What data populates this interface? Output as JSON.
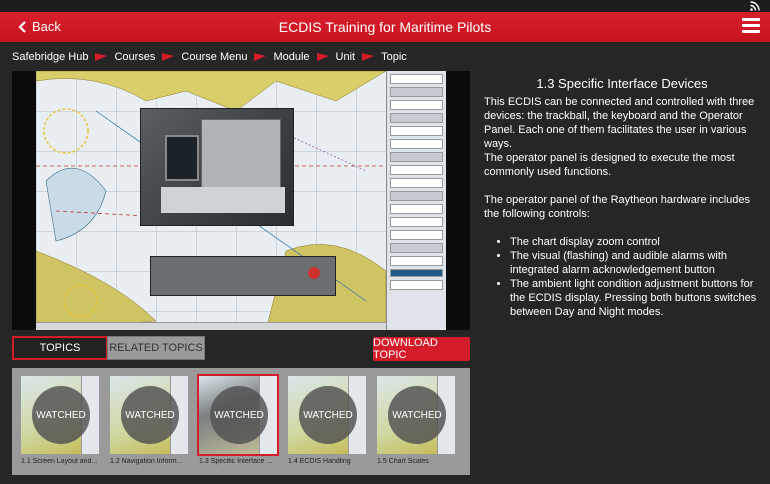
{
  "header": {
    "back_label": "Back",
    "title": "ECDIS Training for Maritime Pilots",
    "rss_icon": "rss-icon",
    "menu_icon": "hamburger-menu-icon",
    "accent_color": "#d51c2a"
  },
  "breadcrumb": [
    "Safebridge Hub",
    "Courses",
    "Course Menu",
    "Module",
    "Unit",
    "Topic"
  ],
  "content": {
    "heading": "1.3 Specific Interface Devices",
    "paragraph1": "This ECDIS can be connected and controlled with three devices: the trackball, the keyboard and the Operator Panel. Each one of them facilitates the user in various ways.",
    "paragraph2": "The operator panel is designed to execute the most commonly used functions.",
    "paragraph3": "The operator panel of the Raytheon hardware includes the following controls:",
    "bullets": [
      "The chart display zoom control",
      "The visual (flashing) and audible alarms with integrated alarm acknowledgement button",
      "The ambient light condition adjustment buttons for the ECDIS display. Pressing both buttons switches between Day and Night modes."
    ]
  },
  "tabs": {
    "topics": "TOPICS",
    "related": "RELATED TOPICS"
  },
  "download_label": "DOWNLOAD TOPIC",
  "topics": [
    {
      "caption": "1.1 Screen Layout and...",
      "status": "WATCHED",
      "active": false
    },
    {
      "caption": "1.2 Navigation Inform...",
      "status": "WATCHED",
      "active": false
    },
    {
      "caption": "1.3 Specific Interface ...",
      "status": "WATCHED",
      "active": true
    },
    {
      "caption": "1.4 ECDIS Handling",
      "status": "WATCHED",
      "active": false
    },
    {
      "caption": "1.5 Chart Scales",
      "status": "WATCHED",
      "active": false
    }
  ]
}
